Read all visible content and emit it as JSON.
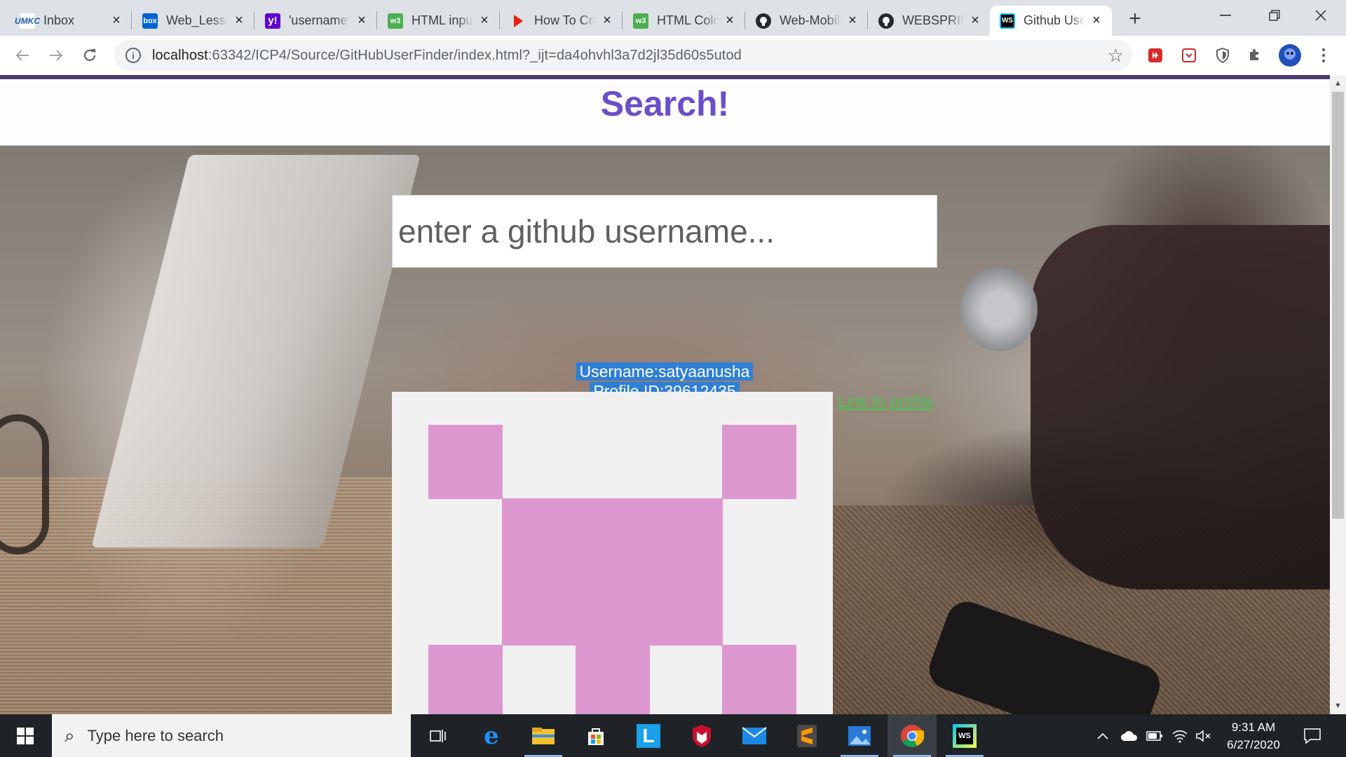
{
  "browser": {
    "tabs": [
      {
        "title": "Inbox",
        "icon": "umkc-mail-icon",
        "color": "#1a5aa8"
      },
      {
        "title": "Web_Lessons",
        "icon": "box-icon",
        "color": "#0061d5"
      },
      {
        "title": "'username'",
        "icon": "yahoo-icon",
        "color": "#6001d2"
      },
      {
        "title": "HTML input",
        "icon": "w3schools-icon",
        "color": "#4caf50"
      },
      {
        "title": "How To Create",
        "icon": "youtube-play-icon",
        "color": "#e62117"
      },
      {
        "title": "HTML Colors",
        "icon": "w3schools-icon",
        "color": "#4caf50"
      },
      {
        "title": "Web-Mobile",
        "icon": "github-icon",
        "color": "#24292e"
      },
      {
        "title": "WEBSPRING",
        "icon": "github-icon",
        "color": "#24292e"
      },
      {
        "title": "Github User Finder",
        "icon": "webstorm-icon",
        "color": "#07c3f2",
        "active": true
      }
    ],
    "url_host": "localhost",
    "url_rest": ":63342/ICP4/Source/GitHubUserFinder/index.html?_ijt=da4ohvhl3a7d2jl35d60s5utod"
  },
  "page": {
    "title": "Search!",
    "search_placeholder": "enter a github username...",
    "username_line": "Username:satyaanusha",
    "profile_id_line": "Profile ID:39612435",
    "profile_link": "Link to profile",
    "accent_color": "#6a4fc9",
    "avatar_color": "#dd97cf",
    "link_color": "#4cc24c"
  },
  "taskbar": {
    "search_placeholder": "Type here to search",
    "time": "9:31 AM",
    "date": "6/27/2020",
    "apps": [
      "task-view-icon",
      "edge-icon",
      "file-explorer-icon",
      "store-icon",
      "l-app-icon",
      "mcafee-icon",
      "mail-icon",
      "sublime-text-icon",
      "photos-icon",
      "chrome-icon",
      "webstorm-icon"
    ]
  }
}
